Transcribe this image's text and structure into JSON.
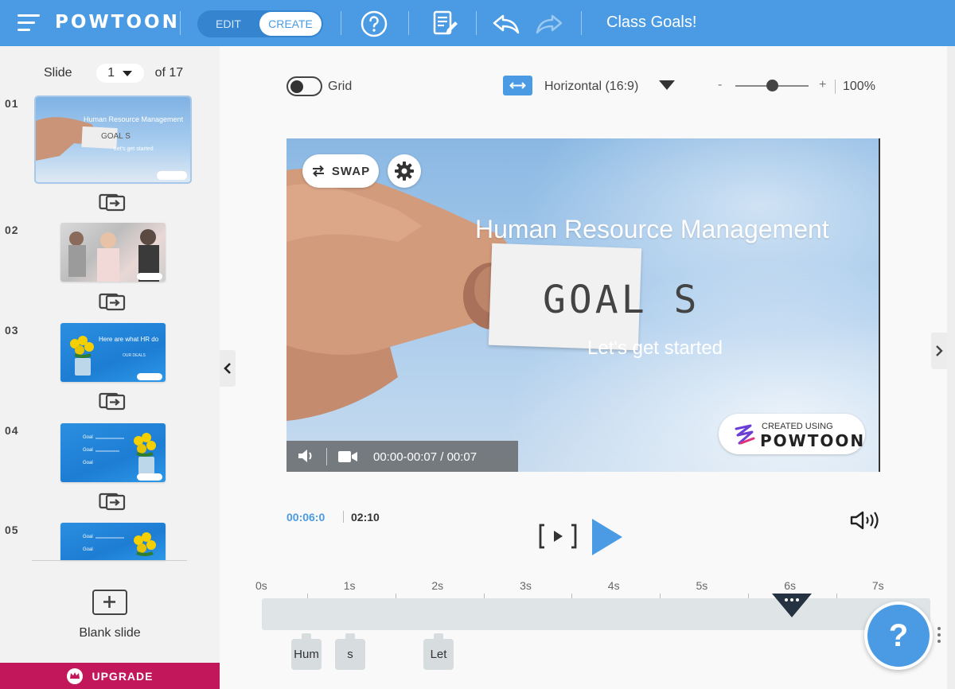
{
  "app": {
    "logo": "POWTOON",
    "title": "Class Goals!"
  },
  "header": {
    "mode_edit": "EDIT",
    "mode_create": "CREATE"
  },
  "sidebar": {
    "slide_prefix": "Slide",
    "current_slide": "1",
    "of_total": "of 17",
    "slides": [
      {
        "num": "01"
      },
      {
        "num": "02"
      },
      {
        "num": "03"
      },
      {
        "num": "04"
      },
      {
        "num": "05"
      }
    ],
    "thumb_texts": {
      "s1_title": "Human Resource Management",
      "s1_paper": "GOAL S",
      "s1_sub": "Let's get started",
      "s3_line1": "Here are what HR do",
      "s3_line2": "OUR DEALS",
      "s4_goal": "Goal"
    },
    "blank_label": "Blank slide",
    "upgrade_label": "UPGRADE"
  },
  "toolbar": {
    "grid_label": "Grid",
    "grid_on": false,
    "orientation": "Horizontal (16:9)",
    "zoom_minus": "-",
    "zoom_plus": "+",
    "zoom_value": "100%",
    "zoom_level": 0.5
  },
  "canvas": {
    "swap_label": "SWAP",
    "title": "Human Resource Management",
    "paper_text": "GOAL S",
    "subtitle": "Let's get started",
    "badge_small": "CREATED USING",
    "badge_big": "POWTOON",
    "time_range": "00:00-00:07 / 00:07"
  },
  "playback": {
    "current": "00:06:0",
    "total": "02:10"
  },
  "timeline": {
    "labels": [
      "0s",
      "1s",
      "2s",
      "3s",
      "4s",
      "5s",
      "6s",
      "7s"
    ],
    "playhead_seconds": 6,
    "chips": [
      {
        "label": "Hum"
      },
      {
        "label": "s"
      },
      {
        "label": "Let"
      }
    ]
  },
  "help": {
    "label": "?"
  },
  "colors": {
    "brand_blue": "#4a9be4",
    "upgrade": "#c2185b"
  }
}
